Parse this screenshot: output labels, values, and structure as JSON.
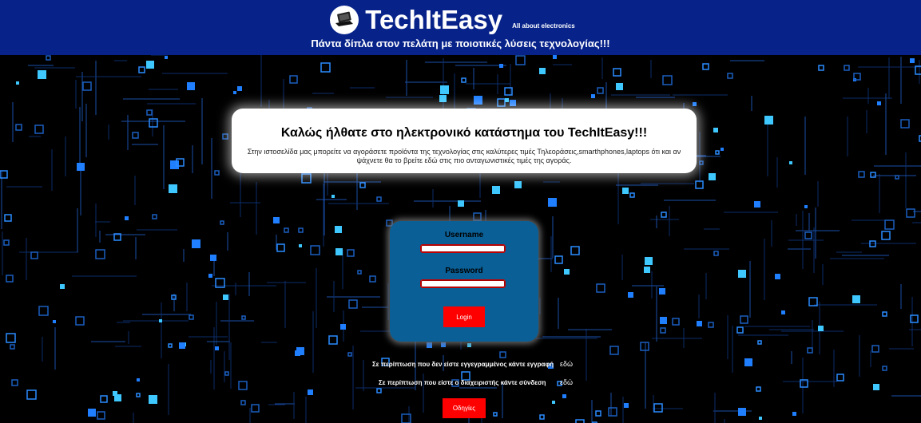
{
  "header": {
    "brand": "TechItEasy",
    "tagline": "All about electronics",
    "motto": "Πάντα δίπλα στον πελάτη με ποιοτικές λύσεις τεχνολογίας!!!",
    "logo_icon": "laptop-icon",
    "background_color": "#07238a"
  },
  "welcome": {
    "title": "Καλώς ήλθατε στο ηλεκτρονικό κατάστημα του TechItEasy!!!",
    "text": "Στην ιστοσελίδα μας μπορείτε να αγοράσετε προϊόντα της τεχνολογίας στις καλύτερες τιμές Τηλεοράσεις,smarthphones,laptops ότι και αν ψάχνετε θα το βρείτε εδώ στις πιο ανταγωνιστικές τιμές της αγοράς."
  },
  "login": {
    "username_label": "Username",
    "password_label": "Password",
    "username_value": "",
    "password_value": "",
    "button_label": "Login",
    "box_color": "#0a5f96"
  },
  "links": {
    "register_note": "Σε περίπτωση που δεν είστε εγγεγραμμένος κάντε εγγραφή",
    "register_link": "εδώ",
    "admin_note": "Σε περίπτωση που είστε ο διαχειριστής κάντε σύνδεση",
    "admin_link": "εδώ"
  },
  "guide_button": "Οδηγίες",
  "accent_color": "#ff0000"
}
